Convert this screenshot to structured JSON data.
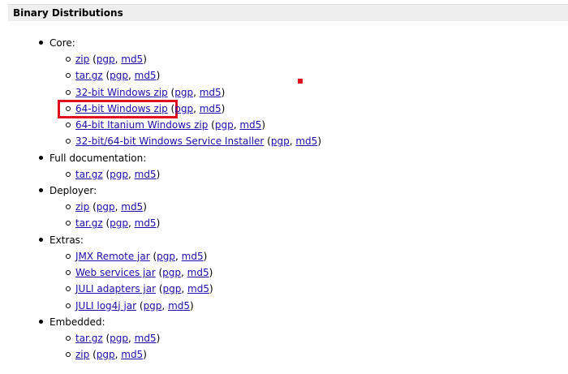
{
  "header": {
    "title": "Binary Distributions"
  },
  "sections": [
    {
      "label": "Core:",
      "items": [
        {
          "label": "zip",
          "sig1": "pgp",
          "sig2": "md5"
        },
        {
          "label": "tar.gz",
          "sig1": "pgp",
          "sig2": "md5"
        },
        {
          "label": "32-bit Windows zip",
          "sig1": "pgp",
          "sig2": "md5"
        },
        {
          "label": "64-bit Windows zip",
          "sig1": "pgp",
          "sig2": "md5"
        },
        {
          "label": "64-bit Itanium Windows zip",
          "sig1": "pgp",
          "sig2": "md5"
        },
        {
          "label": "32-bit/64-bit Windows Service Installer",
          "sig1": "pgp",
          "sig2": "md5"
        }
      ]
    },
    {
      "label": "Full documentation:",
      "items": [
        {
          "label": "tar.gz",
          "sig1": "pgp",
          "sig2": "md5"
        }
      ]
    },
    {
      "label": "Deployer:",
      "items": [
        {
          "label": "zip",
          "sig1": "pgp",
          "sig2": "md5"
        },
        {
          "label": "tar.gz",
          "sig1": "pgp",
          "sig2": "md5"
        }
      ]
    },
    {
      "label": "Extras:",
      "items": [
        {
          "label": "JMX Remote jar",
          "sig1": "pgp",
          "sig2": "md5"
        },
        {
          "label": "Web services jar",
          "sig1": "pgp",
          "sig2": "md5"
        },
        {
          "label": "JULI adapters jar",
          "sig1": "pgp",
          "sig2": "md5"
        },
        {
          "label": "JULI log4j jar",
          "sig1": "pgp",
          "sig2": "md5"
        }
      ]
    },
    {
      "label": "Embedded:",
      "items": [
        {
          "label": "tar.gz",
          "sig1": "pgp",
          "sig2": "md5"
        },
        {
          "label": "zip",
          "sig1": "pgp",
          "sig2": "md5"
        }
      ]
    }
  ],
  "annotations": {
    "highlight_color": "#e01020"
  }
}
